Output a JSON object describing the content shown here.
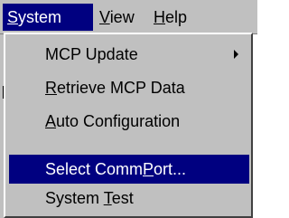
{
  "menubar": {
    "items": [
      {
        "pre": "",
        "key": "S",
        "post": "ystem"
      },
      {
        "pre": "",
        "key": "V",
        "post": "iew"
      },
      {
        "pre": "",
        "key": "H",
        "post": "elp"
      }
    ]
  },
  "menu": {
    "items": [
      {
        "pre": "MCP Update",
        "key": "",
        "post": ""
      },
      {
        "pre": "",
        "key": "R",
        "post": "etrieve MCP Data"
      },
      {
        "pre": "",
        "key": "A",
        "post": "uto Configuration"
      },
      {
        "pre": "Select Comm",
        "key": "P",
        "post": "ort..."
      },
      {
        "pre": "System ",
        "key": "T",
        "post": "est"
      }
    ]
  },
  "colors": {
    "menu_bg": "#c0c0c0",
    "highlight": "#000080",
    "highlight_text": "#ffffff"
  },
  "icons": {
    "submenu": "submenu-arrow-icon"
  }
}
